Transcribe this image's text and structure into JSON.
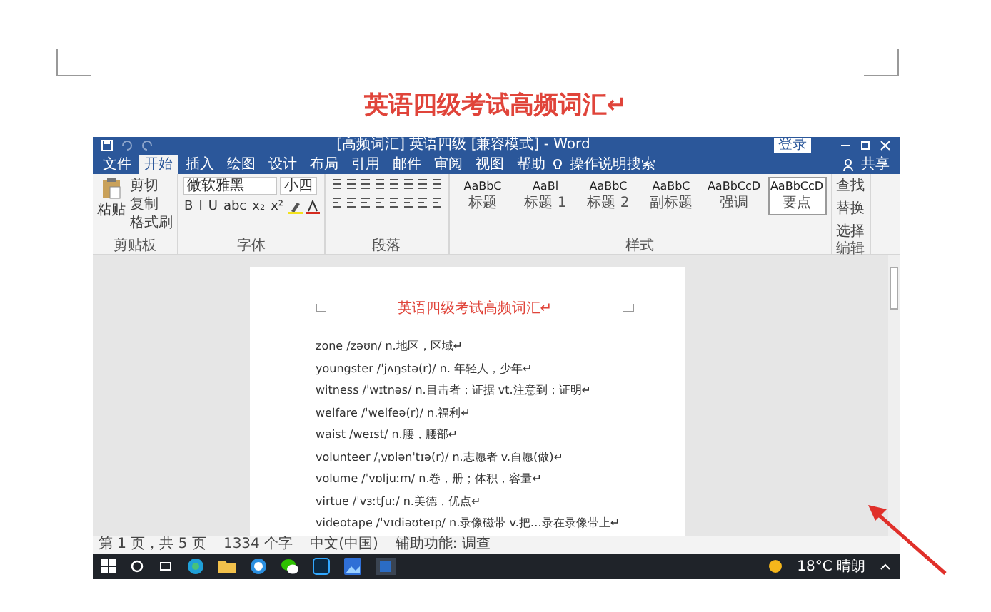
{
  "document": {
    "title": "英语四级考试高频词汇↵"
  },
  "word_window": {
    "title": "[高频词汇] 英语四级 [兼容模式] - Word",
    "login": "登录",
    "share": "共享",
    "search_hint": "操作说明搜索",
    "tabs": [
      {
        "label": "文件",
        "selected": false
      },
      {
        "label": "开始",
        "selected": true
      },
      {
        "label": "插入",
        "selected": false
      },
      {
        "label": "绘图",
        "selected": false
      },
      {
        "label": "设计",
        "selected": false
      },
      {
        "label": "布局",
        "selected": false
      },
      {
        "label": "引用",
        "selected": false
      },
      {
        "label": "邮件",
        "selected": false
      },
      {
        "label": "审阅",
        "selected": false
      },
      {
        "label": "视图",
        "selected": false
      },
      {
        "label": "帮助",
        "selected": false
      }
    ],
    "ribbon": {
      "clipboard": {
        "paste": "粘贴",
        "items": [
          "剪切",
          "复制",
          "格式刷"
        ],
        "label": "剪贴板"
      },
      "font": {
        "name": "微软雅黑",
        "size": "小四",
        "buttons": [
          "B",
          "I",
          "U",
          "abc",
          "x₂",
          "x²"
        ],
        "label": "字体"
      },
      "paragraph": {
        "label": "段落"
      },
      "styles": {
        "items": [
          {
            "sample": "AaBbC",
            "name": "标题",
            "selected": false
          },
          {
            "sample": "AaBl",
            "name": "标题 1",
            "selected": false
          },
          {
            "sample": "AaBbC",
            "name": "标题 2",
            "selected": false
          },
          {
            "sample": "AaBbC",
            "name": "副标题",
            "selected": false
          },
          {
            "sample": "AaBbCcD",
            "name": "强调",
            "selected": false
          },
          {
            "sample": "AaBbCcD",
            "name": "要点",
            "selected": true
          }
        ],
        "label": "样式"
      },
      "editing": {
        "items": [
          "查找",
          "替换",
          "选择"
        ],
        "label": "编辑"
      }
    },
    "page": {
      "heading": "英语四级考试高频词汇↵",
      "lines": [
        "zone /zəʊn/ n.地区，区域↵",
        "youngster /ˈjʌŋstə(r)/ n. 年轻人，少年↵",
        "witness /ˈwɪtnəs/ n.目击者；证据 vt.注意到；证明↵",
        "welfare /ˈwelfeə(r)/ n.福利↵",
        "waist /weɪst/ n.腰，腰部↵",
        "volunteer /ˌvɒlənˈtɪə(r)/ n.志愿者 v.自愿(做)↵",
        "volume /ˈvɒljuːm/ n.卷，册；体积，容量↵",
        "virtue /ˈvɜːtʃuː/ n.美德，优点↵",
        "videotape /ˈvɪdiəʊteɪp/ n.录像磁带 v.把…录在录像带上↵"
      ]
    },
    "status_bar": {
      "page": "第 1 页，共 5 页",
      "words": "1334 个字",
      "language": "中文(中国)",
      "accessibility": "辅助功能: 调查"
    },
    "taskbar": {
      "weather": "18°C 晴朗"
    }
  }
}
